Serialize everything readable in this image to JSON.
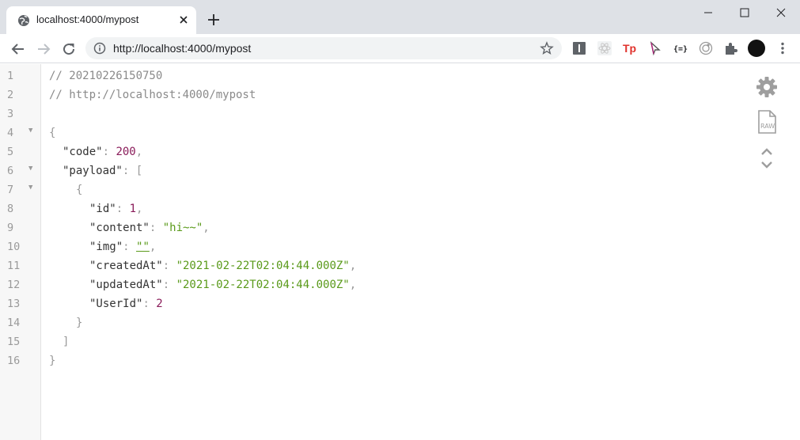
{
  "tab": {
    "title": "localhost:4000/mypost",
    "favicon": "globe-icon"
  },
  "toolbar": {
    "url": "http://localhost:4000/mypost",
    "extensions": [
      "extension-i-icon",
      "extension-react-icon",
      "extension-tp-icon",
      "extension-cursor-icon",
      "extension-json-icon",
      "extension-target-icon",
      "puzzle-icon",
      "profile-avatar"
    ]
  },
  "viewer": {
    "line_numbers": [
      "1",
      "2",
      "3",
      "4",
      "5",
      "6",
      "7",
      "8",
      "9",
      "10",
      "11",
      "12",
      "13",
      "14",
      "15",
      "16"
    ],
    "foldable_lines": [
      4,
      6,
      7
    ],
    "comment_timestamp": "// 20210226150750",
    "comment_url": "// http://localhost:4000/mypost",
    "json": {
      "code": 200,
      "payload": [
        {
          "id": 1,
          "content": "hi~~",
          "img": "",
          "createdAt": "2021-02-22T02:04:44.000Z",
          "updatedAt": "2021-02-22T02:04:44.000Z",
          "UserId": 2
        }
      ]
    },
    "lines": {
      "l1": "// 20210226150750",
      "l2": "// http://localhost:4000/mypost",
      "l4": "{",
      "l5_key": "\"code\"",
      "l5_val": "200",
      "l6_key": "\"payload\"",
      "l6_open": "[",
      "l7": "{",
      "l8_key": "\"id\"",
      "l8_val": "1",
      "l9_key": "\"content\"",
      "l9_val": "\"hi~~\"",
      "l10_key": "\"img\"",
      "l10_val": "\"\"",
      "l11_key": "\"createdAt\"",
      "l11_val": "\"2021-02-22T02:04:44.000Z\"",
      "l12_key": "\"updatedAt\"",
      "l12_val": "\"2021-02-22T02:04:44.000Z\"",
      "l13_key": "\"UserId\"",
      "l13_val": "2",
      "l14": "}",
      "l15": "]",
      "l16": "}"
    },
    "side_tools": [
      "gear-icon",
      "raw-file-icon",
      "collapse-expand-icon"
    ],
    "raw_label": "RAW"
  }
}
